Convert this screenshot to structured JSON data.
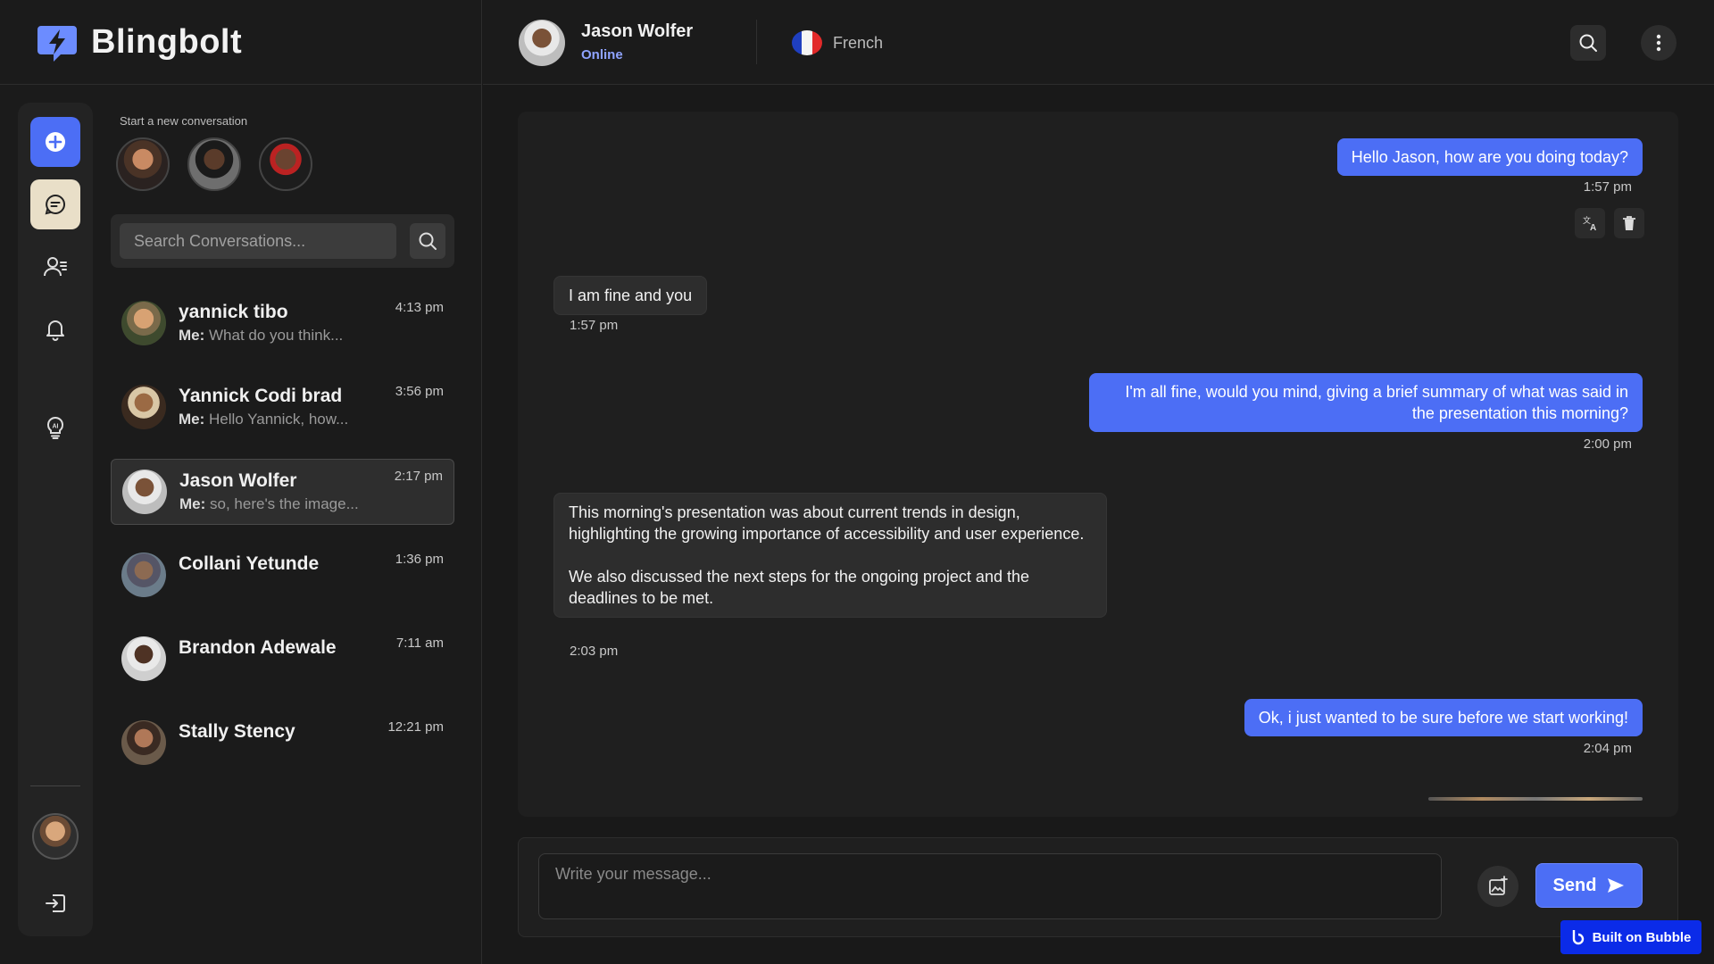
{
  "app": {
    "name": "Blingbolt"
  },
  "sidebar": {
    "new_conversation_label": "Start a new conversation",
    "search": {
      "placeholder": "Search Conversations..."
    },
    "conversations": [
      {
        "name": "yannick tibo",
        "me": "Me:",
        "preview": "What do you think...",
        "time": "4:13 pm"
      },
      {
        "name": "Yannick Codi brad",
        "me": "Me:",
        "preview": "Hello Yannick, how...",
        "time": "3:56 pm"
      },
      {
        "name": "Jason Wolfer",
        "me": "Me:",
        "preview": "so, here's the image...",
        "time": "2:17 pm"
      },
      {
        "name": "Collani Yetunde",
        "me": "",
        "preview": "",
        "time": "1:36 pm"
      },
      {
        "name": "Brandon Adewale",
        "me": "",
        "preview": "",
        "time": "7:11 am"
      },
      {
        "name": "Stally Stency",
        "me": "",
        "preview": "",
        "time": "12:21 pm"
      }
    ]
  },
  "chat": {
    "contact_name": "Jason Wolfer",
    "status": "Online",
    "language": "French",
    "messages": [
      {
        "dir": "out",
        "text": "Hello Jason, how are you doing today?",
        "time": "1:57 pm"
      },
      {
        "dir": "in",
        "text": "I am fine and you",
        "time": "1:57 pm"
      },
      {
        "dir": "out",
        "text": "I'm all fine, would you mind, giving a brief summary of what was said in the presentation this morning?",
        "time": "2:00 pm"
      },
      {
        "dir": "in",
        "text_p1": "This morning's presentation was about current trends in design, highlighting the growing importance of accessibility and user experience.",
        "text_p2": "We also discussed the next steps for the ongoing project and the deadlines to be met.",
        "time": "2:03 pm"
      },
      {
        "dir": "out",
        "text": "Ok, i just wanted to be sure before we start working!",
        "time": "2:04 pm"
      }
    ]
  },
  "composer": {
    "placeholder": "Write your message...",
    "send_label": "Send"
  },
  "badge": {
    "label": "Built on Bubble"
  },
  "colors": {
    "accent": "#4c6ef5",
    "status_online": "#8fa3ff",
    "background": "#191919",
    "badge": "#0b2be8"
  },
  "icons": {
    "rail": [
      "plus-icon",
      "chat-icon",
      "contacts-icon",
      "bell-icon",
      "ai-bulb-icon",
      "logout-icon"
    ],
    "header": [
      "search-icon",
      "more-vertical-icon"
    ],
    "message_actions": [
      "translate-icon",
      "trash-icon"
    ],
    "composer": [
      "image-add-icon",
      "send-arrow-icon"
    ]
  }
}
